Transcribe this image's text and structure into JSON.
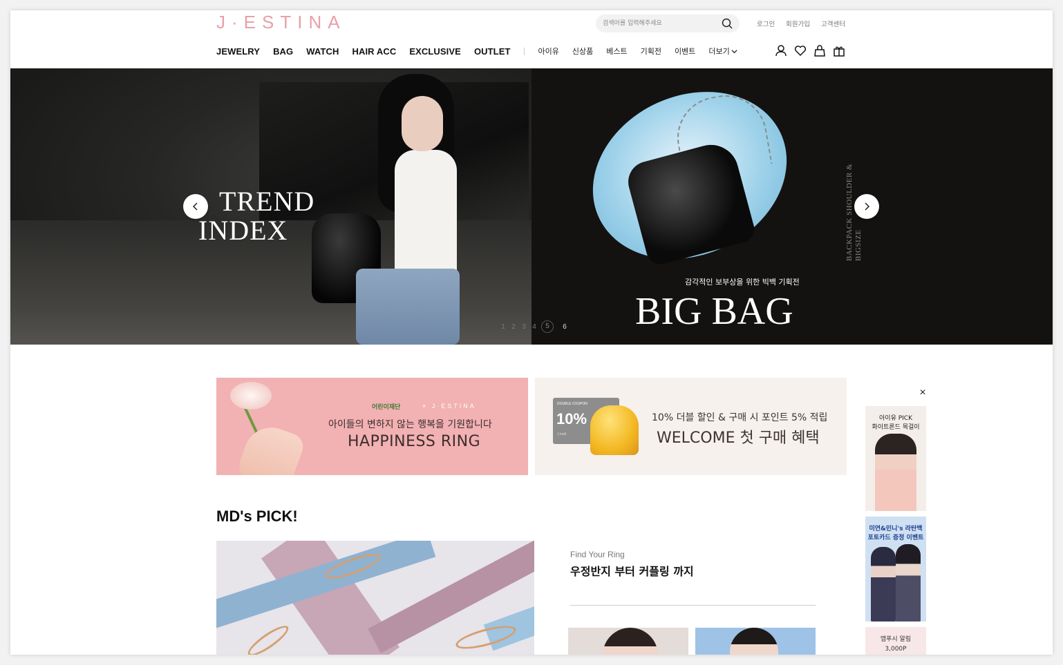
{
  "header": {
    "logo": "J·ESTINA",
    "search_placeholder": "검색어를 입력해주세요",
    "util_links": [
      "로그인",
      "회원가입",
      "고객센터"
    ],
    "main_menu": [
      "JEWELRY",
      "BAG",
      "WATCH",
      "HAIR ACC",
      "EXCLUSIVE",
      "OUTLET"
    ],
    "sub_menu": [
      "아이유",
      "신상품",
      "베스트",
      "기획전",
      "이벤트"
    ],
    "more_label": "더보기",
    "icons": [
      "user-icon",
      "heart-icon",
      "cart-icon",
      "gift-icon"
    ]
  },
  "hero": {
    "left_title_line1": "TREND",
    "left_title_line2": "INDEX",
    "right_subtitle": "감각적인 보부상을 위한 빅백 기획전",
    "right_title": "BIG BAG",
    "vertical_text": "BACKPACK SHOULDER & BIGSIZE",
    "pager": [
      "1",
      "2",
      "3",
      "4",
      "5",
      "6"
    ],
    "active_page": "5"
  },
  "banners": {
    "happiness": {
      "brand_left": "어린이재단",
      "brand_right": "× J·ESTINA",
      "line1": "아이들의 변하지 않는 행복을 기원합니다",
      "line2": "HAPPINESS RING"
    },
    "welcome": {
      "coupon_label": "DOUBLE COUPON",
      "coupon_value": "10%",
      "coupon_foot": "J.mall",
      "line1": "10% 더블 할인 & 구매 시 포인트 5% 적립",
      "line2": "WELCOME 첫 구매 혜택"
    }
  },
  "side_banners": {
    "close_label": "×",
    "card1": [
      "아이유 PICK",
      "화이트론드 목걸이"
    ],
    "card2": [
      "미연&민니's 라탄백",
      "포토카드 증정 이벤트"
    ],
    "card3": [
      "앱푸시 알림",
      "3,000P"
    ]
  },
  "md_pick": {
    "title": "MD's PICK!",
    "find_label": "Find Your Ring",
    "headline": "우정반지 부터 커플링 까지"
  }
}
